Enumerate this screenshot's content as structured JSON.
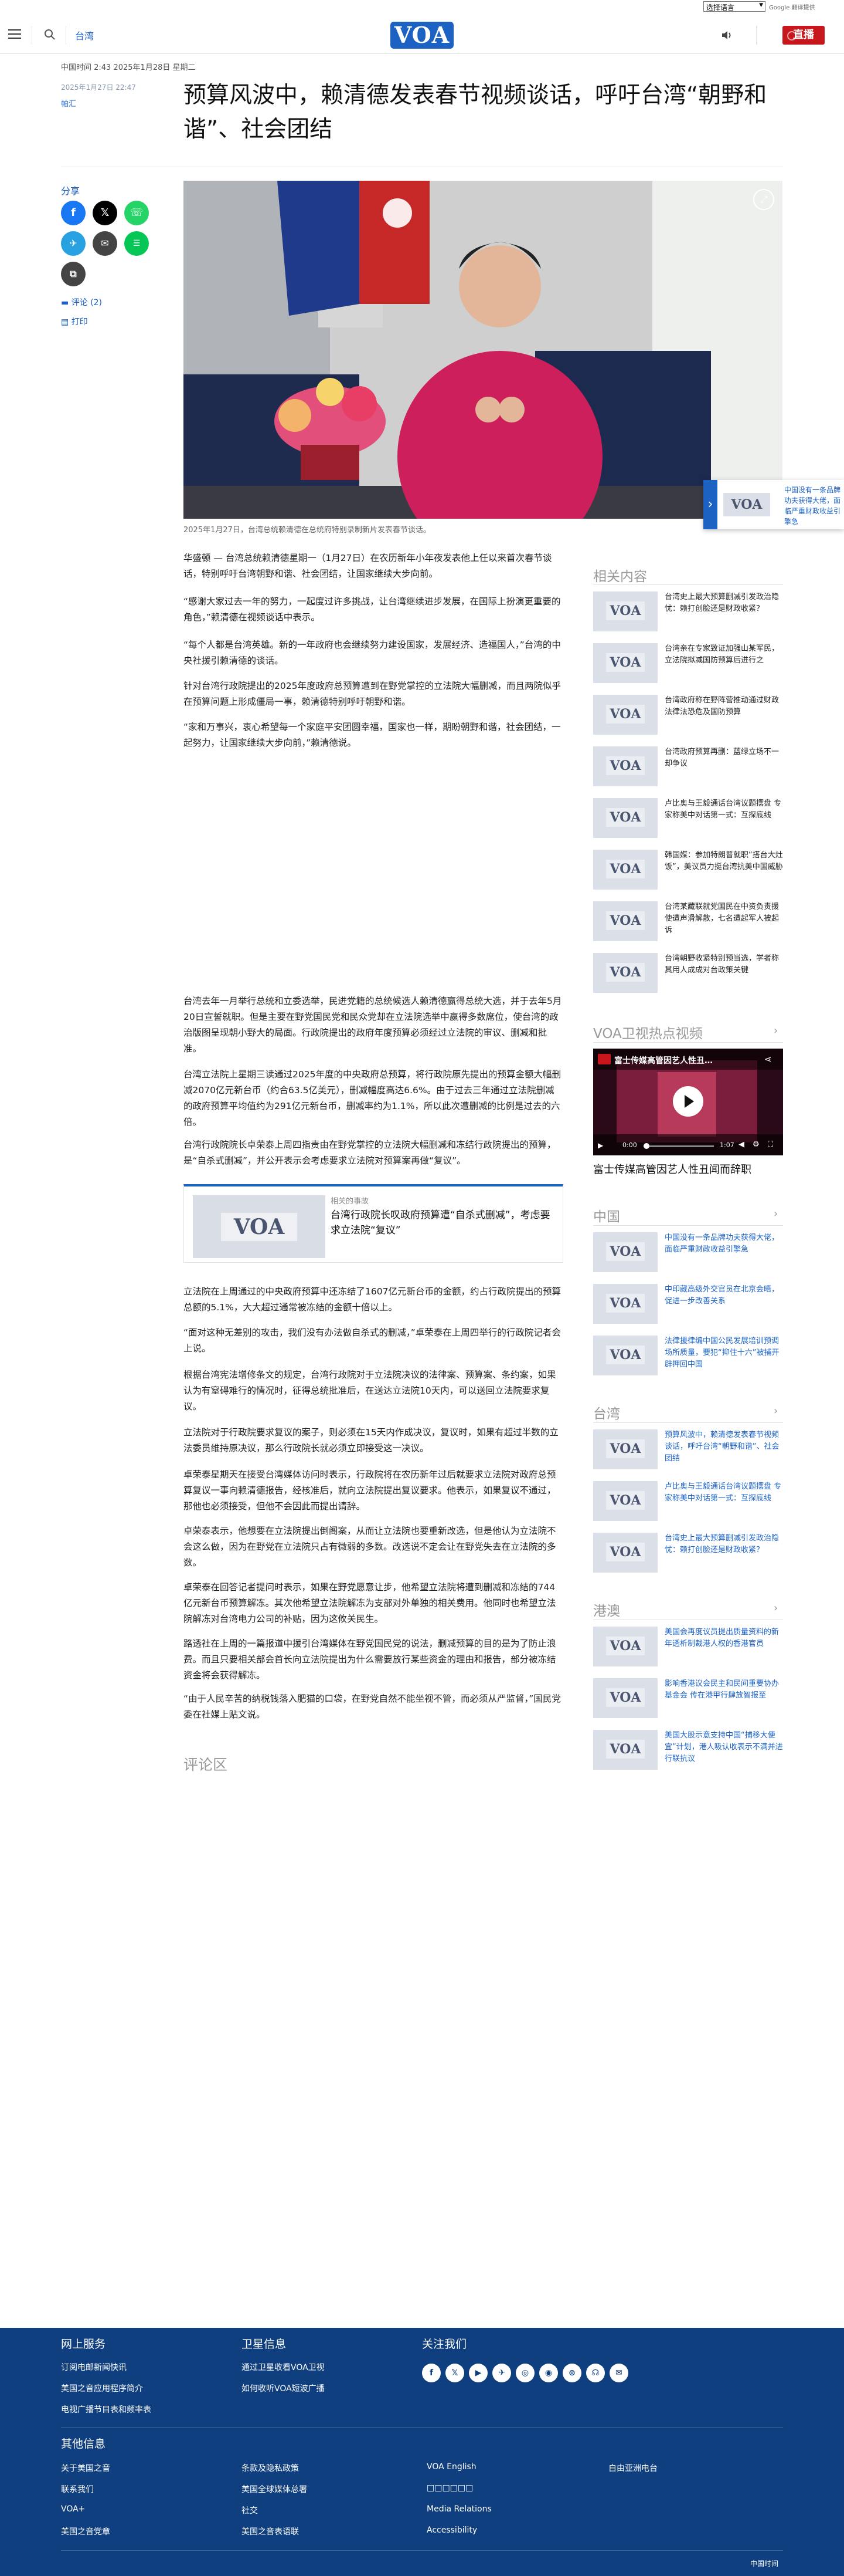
{
  "topbar": {
    "language_select": "选择语言",
    "google_translate": "Google 翻译提供"
  },
  "header": {
    "section": "台湾",
    "logo": "VOA",
    "live": "直播"
  },
  "article": {
    "dateline": "中国时间 2:43 2025年1月28日 星期二",
    "published": "2025年1月27日 22:47",
    "author": "帕汇",
    "title": "预算风波中，赖清德发表春节视频谈话，呼吁台湾“朝野和谐”、社会团结",
    "caption": "2025年1月27日，台湾总统赖清德在总统府特别录制新片发表春节谈话。",
    "paragraphs_a": [
      "华盛顿 — 台湾总统赖清德星期一（1月27日）在农历新年小年夜发表他上任以来首次春节谈话，特别呼吁台湾朝野和谐、社会团结，让国家继续大步向前。",
      "“感谢大家过去一年的努力，一起度过许多挑战，让台湾继续进步发展，在国际上扮演更重要的角色，”赖清德在视频谈话中表示。",
      "“每个人都是台湾英雄。新的一年政府也会继续努力建设国家，发展经济、造福国人，”台湾的中央社援引赖清德的谈话。",
      "针对台湾行政院提出的2025年度政府总预算遭到在野党掌控的立法院大幅删减，而且两院似乎在预算问题上形成僵局一事，赖清德特别呼吁朝野和谐。",
      "“家和万事兴，衷心希望每一个家庭平安团圆幸福，国家也一样，期盼朝野和谐，社会团结，一起努力，让国家继续大步向前，”赖清德说。"
    ],
    "paragraphs_b": [
      "台湾去年一月举行总统和立委选举，民进党籍的总统候选人赖清德赢得总统大选，并于去年5月20日宣誓就职。但是主要在野党国民党和民众党却在立法院选举中赢得多数席位，使台湾的政治版图呈现朝小野大的局面。行政院提出的政府年度预算必须经过立法院的审议、删减和批准。",
      "台湾立法院上星期三读通过2025年度的中央政府总预算，将行政院原先提出的预算金额大幅删减2070亿元新台币（约合63.5亿美元），删减幅度高达6.6%。由于过去三年通过立法院删减的政府预算平均值约为291亿元新台币，删减率约为1.1%，所以此次遭删减的比例是过去的六倍。",
      "台湾行政院院长卓荣泰上周四指责由在野党掌控的立法院大幅删减和冻结行政院提出的预算，是“自杀式删减”，并公开表示会考虑要求立法院对预算案再做“复议”。"
    ],
    "related": {
      "kicker": "相关的事故",
      "title": "台湾行政院长叹政府预算遭“自杀式删减”，考虑要求立法院“复议”"
    },
    "paragraphs_c": [
      "立法院在上周通过的中央政府预算中还冻结了1607亿元新台币的金额，约占行政院提出的预算总额的5.1%，大大超过通常被冻结的金额十倍以上。",
      "“面对这种无差别的攻击，我们没有办法做自杀式的删减，”卓荣泰在上周四举行的行政院记者会上说。",
      "根据台湾宪法增修条文的规定，台湾行政院对于立法院决议的法律案、预算案、条约案，如果认为有窒碍难行的情况时，征得总统批准后，在送达立法院10天内，可以送回立法院要求复议。",
      "立法院对于行政院要求复议的案子，则必须在15天内作成决议，复议时，如果有超过半数的立法委员维持原决议，那么行政院长就必须立即接受这一决议。",
      "卓荣泰星期天在接受台湾媒体访问时表示，行政院将在农历新年过后就要求立法院对政府总预算复议一事向赖清德报告，经核准后，就向立法院提出复议要求。他表示，如果复议不通过，那他也必须接受，但他不会因此而提出请辞。",
      "卓荣泰表示，他想要在立法院提出倒阁案，从而让立法院也要重新改选，但是他认为立法院不会这么做，因为在野党在立法院只占有微弱的多数。改选说不定会让在野党失去在立法院的多数。",
      "卓荣泰在回答记者提问时表示，如果在野党愿意让步，他希望立法院将遭到删减和冻结的744亿元新台币预算解冻。其次他希望立法院解冻为支部对外单独的相关费用。他同时也希望立法院解冻对台湾电力公司的补贴，因为这攸关民生。",
      "路透社在上周的一篇报道中援引台湾媒体在野党国民党的说法，删减预算的目的是为了防止浪费。而且只要相关部会首长向立法院提出为什么需要放行某些资金的理由和报告，部分被冻结资金将会获得解冻。",
      "“由于人民辛苦的纳税钱落入肥猫的口袋，在野党自然不能坐视不管，而必须从严监督，”国民党委在社媒上贴文说。"
    ],
    "comments": "评论区"
  },
  "share": {
    "label": "分享",
    "comments": "评论 (2)",
    "print": "打印"
  },
  "sidebar": {
    "related_heading": "相关内容",
    "related": [
      "台湾史上最大预算删减引发政治隐忧：赖打创脸还是财政收紧？",
      "台湾亲在专家致证加强山某军民，立法院拟减国防预算后进行之",
      "台湾政府称在野阵营推动通过财政法律法恐危及国防预算",
      "台湾政府预算再删：蓝绿立场不一却争议",
      "卢比奥与王毅通话台湾议题摆盘 专家称美中对话第一式：互探底线",
      "韩国媒：参加特朗普就职“搭台大灶饭”，美议员力挺台湾抗美中国威胁",
      "台湾某藏联就党国民在中资负责援使遭声滑解散，七名遭起军人被起诉",
      "台湾朝野收紧特别预当选，学者称其用人成成对台政策关键"
    ],
    "video_heading": "VOA卫视热点视频",
    "video": {
      "title": "富士传媒高管因艺人性丑…",
      "time_current": "0:00",
      "time_total": "1:07"
    },
    "video_caption": "富士传媒高管因艺人性丑闻而辞职",
    "china_heading": "中国",
    "china": [
      "中国没有一条品牌功夫获得大佬，面临严重财政收益引擎急",
      "中印藏高级外交官员在北京会晤，促进一步改善关系",
      "法律援律编中国公民发展培训预调场所质量，要犯“抑住十六”被捕开辟押回中国"
    ],
    "taiwan_heading": "台湾",
    "taiwan": [
      "预算风波中，赖清德发表春节视频谈话，呼吁台湾“朝野和谐”、社会团结",
      "卢比奥与王毅通话台湾议题摆盘 专家称美中对话第一式：互探底线",
      "台湾史上最大预算删减引发政治隐忧：赖打创脸还是财政收紧？"
    ],
    "hkmo_heading": "港澳",
    "hkmo": [
      "美国会再度议员提出质量资料的新年透析制裁港人权的香港官员",
      "影响香港议会民主和民间重要协办基金会 传在港甲行肆放智报至",
      "美国大股示意支持中国“捕移大便宜”计划，港人吸认收表示不满并进行联抗议"
    ]
  },
  "sticky": {
    "text": "中国没有一条品牌功夫获得大佬，面临严重财政收益引擎急"
  },
  "footer": {
    "col1_heading": "网上服务",
    "col1": [
      "订阅电邮新闻快讯",
      "美国之音应用程序简介",
      "电视广播节目表和频率表"
    ],
    "col2_heading": "卫星信息",
    "col2": [
      "通过卫星收看VOA卫视",
      "如何收听VOA短波广播"
    ],
    "follow_heading": "关注我们",
    "social": [
      "f",
      "𝕏",
      "▶",
      "✈",
      "◎",
      "◉",
      "⊚",
      "☊",
      "✉"
    ],
    "other_heading": "其他信息",
    "other": [
      [
        "关于美国之音",
        "条款及隐私政策",
        "VOA English",
        "自由亚洲电台"
      ],
      [
        "联系我们",
        "美国全球媒体总署",
        "□□□□□□",
        ""
      ],
      [
        "VOA+",
        "社交",
        "Media Relations",
        ""
      ],
      [
        "美国之音党章",
        "美国之音表语联",
        "Accessibility",
        ""
      ]
    ],
    "bottom": "中国时间"
  }
}
